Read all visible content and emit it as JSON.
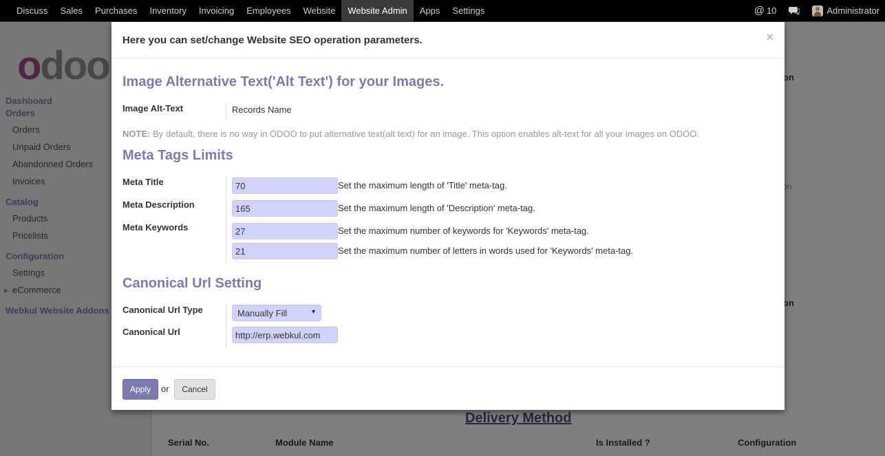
{
  "topnav": {
    "menu": [
      "Discuss",
      "Sales",
      "Purchases",
      "Inventory",
      "Invoicing",
      "Employees",
      "Website",
      "Website Admin",
      "Apps",
      "Settings"
    ],
    "active": "Website Admin",
    "mentions_count": "10",
    "user": "Administrator"
  },
  "sidebar": {
    "logo": "odoo",
    "dashboard": "Dashboard",
    "orders_section": "Orders",
    "orders_items": [
      "Orders",
      "Unpaid Orders",
      "Abandonned Orders",
      "Invoices"
    ],
    "catalog_section": "Catalog",
    "catalog_items": [
      "Products",
      "Pricelists"
    ],
    "configuration_section": "Configuration",
    "configuration_items": [
      "Settings",
      "eCommerce"
    ],
    "webkul_section": "Webkul Website Addons"
  },
  "background": {
    "col_frag_1": "on",
    "col_frag_2": "on",
    "col_frag_3": "on",
    "delivery_title": "Delivery Method",
    "columns": [
      "Serial No.",
      "Module Name",
      "Is Installed ?",
      "Configuration"
    ]
  },
  "modal": {
    "title": "Here you can set/change Website SEO operation parameters.",
    "close": "×",
    "alt_section": "Image Alternative Text('Alt Text') for your Images.",
    "alt_label": "Image Alt-Text",
    "alt_value": "Records Name",
    "note_prefix": "NOTE:",
    "note_text": " By default, there is no way in ODOO to put alternative text(alt text) for an image. This option enables alt-text for all your images on ODOO.",
    "meta_section": "Meta Tags Limits",
    "meta_title_label": "Meta Title",
    "meta_title_value": "70",
    "meta_title_help": "Set the maximum length of 'Title' meta-tag.",
    "meta_desc_label": "Meta Description",
    "meta_desc_value": "165",
    "meta_desc_help": "Set the maximum length of 'Description' meta-tag.",
    "meta_kw_label": "Meta Keywords",
    "meta_kw_value": "27",
    "meta_kw_help": "Set the maximum number of keywords for 'Keywords' meta-tag.",
    "meta_kw_letters_value": "21",
    "meta_kw_letters_help": "Set the maximum number of letters in words used for 'Keywords' meta-tag.",
    "canon_section": "Canonical Url Setting",
    "canon_type_label": "Canonical Url Type",
    "canon_type_value": "Manually Fill",
    "canon_url_label": "Canonical Url",
    "canon_url_value": "http://erp.webkul.com",
    "apply": "Apply",
    "or": "or",
    "cancel": "Cancel"
  },
  "colors": {
    "accent": "#7c7bad",
    "input_bg": "#d2d2ff",
    "navbar": "#000000"
  },
  "icons": {
    "mention": "at-icon",
    "chat": "chat-bubble-icon",
    "close": "close-icon",
    "dropdown": "caret-down-icon"
  }
}
